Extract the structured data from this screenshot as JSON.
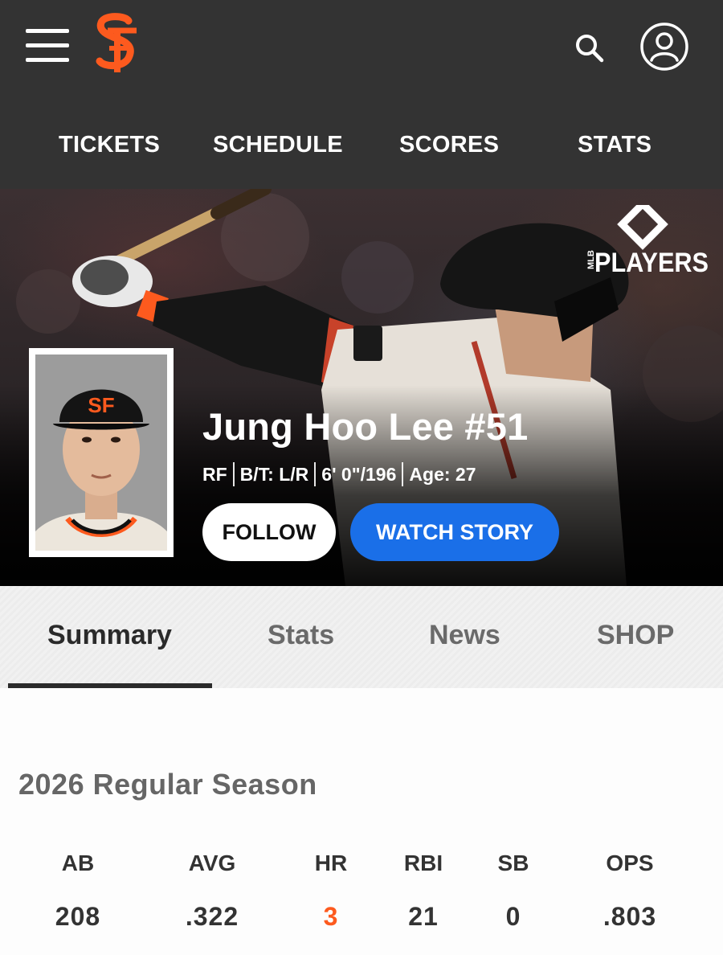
{
  "header": {
    "nav": [
      "TICKETS",
      "SCHEDULE",
      "SCORES",
      "STATS"
    ]
  },
  "hero": {
    "badge_text": "PLAYERS",
    "badge_sub": "MLB",
    "player_name": "Jung Hoo Lee #51",
    "bio": {
      "position": "RF",
      "bats_throws": "B/T: L/R",
      "height_weight": "6' 0\"/196",
      "age": "Age: 27"
    },
    "follow_label": "FOLLOW",
    "watch_label": "WATCH STORY"
  },
  "tabs": [
    {
      "label": "Summary",
      "active": true
    },
    {
      "label": "Stats",
      "active": false
    },
    {
      "label": "News",
      "active": false
    },
    {
      "label": "SHOP",
      "active": false
    }
  ],
  "season": {
    "title": "2026 Regular Season",
    "stats": [
      {
        "label": "AB",
        "value": "208",
        "highlight": false
      },
      {
        "label": "AVG",
        "value": ".322",
        "highlight": false
      },
      {
        "label": "HR",
        "value": "3",
        "highlight": true
      },
      {
        "label": "RBI",
        "value": "21",
        "highlight": false
      },
      {
        "label": "SB",
        "value": "0",
        "highlight": false
      },
      {
        "label": "OPS",
        "value": ".803",
        "highlight": false
      }
    ]
  },
  "colors": {
    "header_bg": "#333333",
    "brand_orange": "#fd5a1e",
    "watch_blue": "#1a6fe8"
  },
  "icons": [
    "hamburger-menu-icon",
    "giants-sf-logo",
    "search-icon",
    "account-icon",
    "mlb-players-logo"
  ]
}
